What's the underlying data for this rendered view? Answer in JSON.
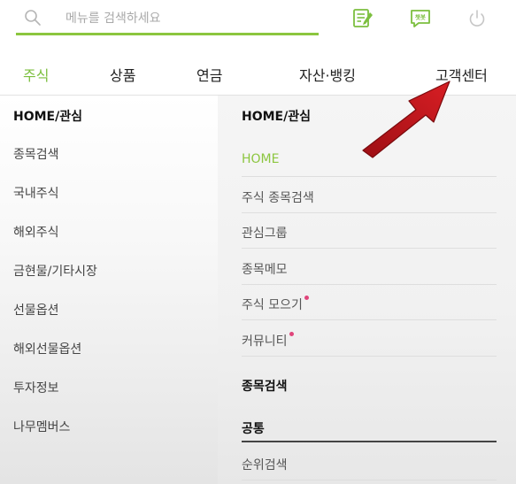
{
  "search": {
    "placeholder": "메뉴를 검색하세요"
  },
  "top_icons": [
    "search-icon",
    "memo-icon",
    "chat-icon",
    "power-icon"
  ],
  "chat_icon_text": "챗봇",
  "tabs": [
    {
      "label": "주식",
      "active": true
    },
    {
      "label": "상품"
    },
    {
      "label": "연금"
    },
    {
      "label": "자산·뱅킹"
    },
    {
      "label": "고객센터"
    }
  ],
  "left_menu": [
    {
      "label": "HOME/관심",
      "selected": true
    },
    {
      "label": "종목검색"
    },
    {
      "label": "국내주식"
    },
    {
      "label": "해외주식"
    },
    {
      "label": "금현물/기타시장"
    },
    {
      "label": "선물옵션"
    },
    {
      "label": "해외선물옵션"
    },
    {
      "label": "투자정보"
    },
    {
      "label": "나무멤버스"
    }
  ],
  "right_menu": {
    "section1_title": "HOME/관심",
    "items": [
      {
        "label": "HOME",
        "active": true
      },
      {
        "label": "주식 종목검색"
      },
      {
        "label": "관심그룹"
      },
      {
        "label": "종목메모"
      },
      {
        "label": "주식 모으기",
        "new": true
      },
      {
        "label": "커뮤니티",
        "new": true
      }
    ],
    "section2_title": "종목검색",
    "sub_head": "공통",
    "sub_items": [
      {
        "label": "순위검색"
      }
    ]
  },
  "colors": {
    "accent": "#8cc63f",
    "new_dot": "#e0457b",
    "arrow": "#c8161d"
  }
}
